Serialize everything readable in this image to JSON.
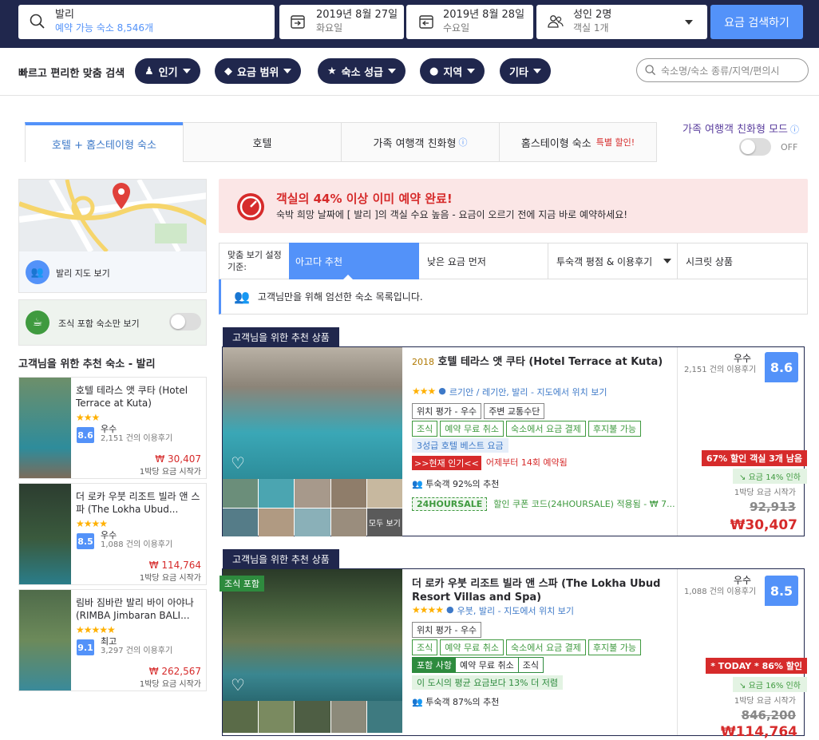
{
  "search": {
    "destination": "발리",
    "availability": "예약 가능 숙소 8,546개",
    "checkin": "2019년 8월 27일",
    "checkin_day": "화요일",
    "checkout": "2019년 8월 28일",
    "checkout_day": "수요일",
    "guests": "성인 2명",
    "rooms": "객실 1개",
    "button": "요금 검색하기"
  },
  "filters": {
    "label": "빠르고 편리한 맞춤 검색",
    "pills": [
      "인기",
      "요금 범위",
      "숙소 성급",
      "지역",
      "기타"
    ],
    "search_placeholder": "숙소명/숙소 종류/지역/편의시"
  },
  "tabs": [
    {
      "label": "호텔 + 홈스테이형 숙소"
    },
    {
      "label": "호텔"
    },
    {
      "label": "가족 여행객 친화형"
    },
    {
      "label": "홈스테이형 숙소",
      "badge": "특별 할인!"
    }
  ],
  "family_mode": {
    "label": "가족 여행객 친화형 모드",
    "state": "OFF"
  },
  "sidebar": {
    "map_label": "발리 지도 보기",
    "breakfast_label": "조식 포함 숙소만 보기",
    "recommend_title": "고객님을 위한 추천 숙소 - 발리",
    "items": [
      {
        "name": "호텔 테라스 앳 쿠타 (Hotel Terrace at Kuta)",
        "stars": "★★★",
        "score": "8.6",
        "rating": "우수",
        "reviews": "2,151 건의 이용후기",
        "price": "₩ 30,407",
        "price_note": "1박당 요금 시작가"
      },
      {
        "name": "더 로카 우붓 리조트 빌라 앤 스파 (The Lokha Ubud...",
        "stars": "★★★★",
        "score": "8.5",
        "rating": "우수",
        "reviews": "1,088 건의 이용후기",
        "price": "₩ 114,764",
        "price_note": "1박당 요금 시작가"
      },
      {
        "name": "림바 짐바란 발리 바이 아야나 (RIMBA Jimbaran BALI...",
        "stars": "★★★★★",
        "score": "9.1",
        "rating": "최고",
        "reviews": "3,297 건의 이용후기",
        "price": "₩ 262,567",
        "price_note": "1박당 요금 시작가"
      }
    ]
  },
  "alert": {
    "title": "객실의 44% 이상 이미 예약 완료!",
    "body": "숙박 희망 날짜에 [ 발리 ]의 객실 수요 높음 - 요금이 오르기 전에 지금 바로 예약하세요!"
  },
  "sort": {
    "label": "맞춤 보기 설정 기준:",
    "options": [
      "아고다 추천",
      "낮은 요금 먼저",
      "투숙객 평점 & 이용후기",
      "시크릿 상품"
    ]
  },
  "notice": "고객님만을 위해 엄선한 숙소 목록입니다.",
  "results": [
    {
      "ribbon": "고객님을 위한 추천 상품",
      "year": "2018",
      "name": "호텔 테라스 앳 쿠타 (Hotel Terrace at Kuta)",
      "stars": "★★★",
      "location": "르기안 / 레기안, 발리 - 지도에서 위치 보기",
      "tags_dark": [
        "위치 평가 - 우수",
        "주변 교통수단"
      ],
      "tags_green": [
        "조식",
        "예약 무료 취소",
        "숙소에서 요금 결제",
        "후지불 가능"
      ],
      "best": "3성급 호텔 베스트 요금",
      "hot": ">>현재 인기<<",
      "hot_text": "어제부터 14회 예약됨",
      "guests": "투숙객 92%의 추천",
      "coupon": "24HOURSALE",
      "coupon_text": "할인 쿠폰 코드(24HOURSALE) 적용됨 - ₩ 7...",
      "rating": "우수",
      "reviews": "2,151 건의 이용후기",
      "score": "8.6",
      "deal": "67% 할인 객실 3개 남음",
      "drop": "요금 14% 인하",
      "price_note": "1박당 요금 시작가",
      "old_price": "92,913",
      "price": "₩30,407",
      "see_all": "모두 보기"
    },
    {
      "ribbon": "고객님을 위한 추천 상품",
      "badge": "조식 포함",
      "name": "더 로카 우붓 리조트 빌라 앤 스파 (The Lokha Ubud Resort Villas and Spa)",
      "stars": "★★★★",
      "location": "우붓, 발리 - 지도에서 위치 보기",
      "tags_dark": [
        "위치 평가 - 우수"
      ],
      "tags_green": [
        "조식",
        "예약 무료 취소",
        "숙소에서 요금 결제",
        "후지불 가능"
      ],
      "tags_pack": [
        "포함 사항",
        "예약 무료 취소",
        "조식"
      ],
      "promo": "이 도시의 평균 요금보다 13% 더 저렴",
      "guests": "투숙객 87%의 추천",
      "rating": "우수",
      "reviews": "1,088 건의 이용후기",
      "score": "8.5",
      "deal": "* TODAY * 86% 할인",
      "drop": "요금 16% 인하",
      "price_note": "1박당 요금 시작가",
      "old_price": "846,200",
      "price": "₩114,764"
    }
  ]
}
